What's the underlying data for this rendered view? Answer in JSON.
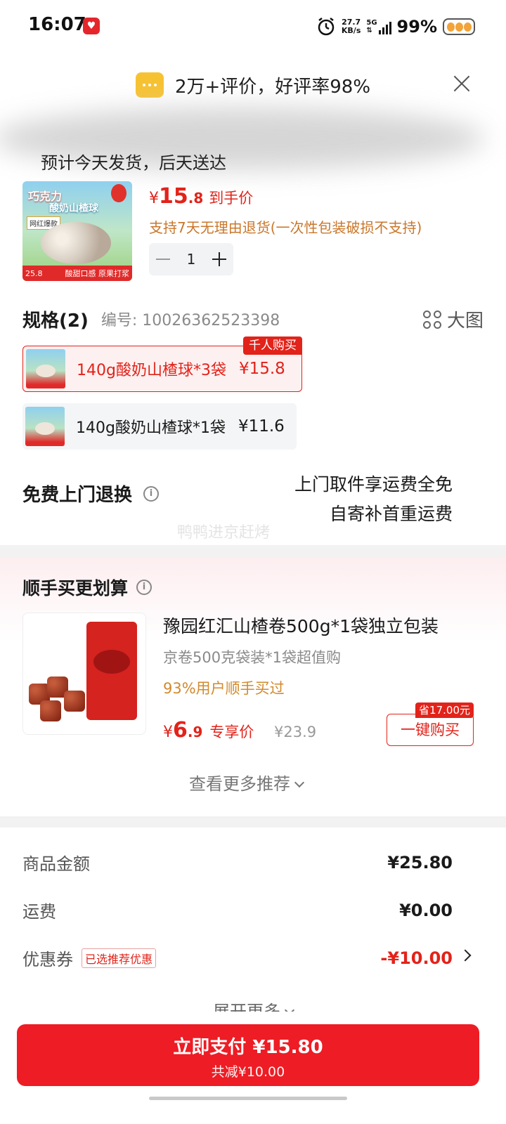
{
  "status": {
    "time": "16:07",
    "net_speed_value": "27.7",
    "net_speed_unit": "KB/s",
    "network": "5G",
    "battery": "99%"
  },
  "header": {
    "tip": "2万+评价，好评率98%"
  },
  "delivery": "预计今天发货，后天送达",
  "product": {
    "image_title": "巧克力",
    "image_subtitle": "酸奶山楂球",
    "image_badge": "网红爆款",
    "image_strip_price": "25.8",
    "image_strip_text": "酸甜口感 原果打浆",
    "price_symbol": "¥",
    "price_int": "15",
    "price_dec": ".8",
    "price_tag": "到手价",
    "return_policy": "支持7天无理由退货(一次性包装破损不支持)",
    "quantity": "1"
  },
  "spec": {
    "title": "规格(2)",
    "code": "编号: 10026362523398",
    "big_view": "大图",
    "options": [
      {
        "label": "140g酸奶山楂球*3袋",
        "price": "¥15.8",
        "badge": "千人购买",
        "selected": true
      },
      {
        "label": "140g酸奶山楂球*1袋",
        "price": "¥11.6",
        "selected": false
      }
    ]
  },
  "free_return": {
    "title": "免费上门退换",
    "line1": "上门取件享运费全免",
    "line2": "自寄补首重运费",
    "watermark": "鸭鸭进京赶烤"
  },
  "recommend": {
    "title": "顺手买更划算",
    "item": {
      "name": "豫园红汇山楂卷500g*1袋独立包装",
      "subtitle": "京卷500克袋装*1袋超值购",
      "popularity": "93%用户顺手买过",
      "price_symbol": "¥",
      "price_int": "6",
      "price_dec": ".9",
      "price_tag": "专享价",
      "original_price": "¥23.9",
      "save_badge": "省17.00元",
      "buy_label": "一键购买"
    },
    "more": "查看更多推荐"
  },
  "summary": {
    "rows": [
      {
        "label": "商品金额",
        "value": "¥25.80"
      },
      {
        "label": "运费",
        "value": "¥0.00"
      },
      {
        "label": "优惠券",
        "tag": "已选推荐优惠",
        "value": "-¥10.00"
      }
    ],
    "expand": "展开更多"
  },
  "pay": {
    "label": "立即支付 ¥15.80",
    "discount": "共减¥10.00"
  },
  "colors": {
    "accent_red": "#e2231a",
    "pay_button": "#ee1c24",
    "orange_text": "#c9772b",
    "tip_icon": "#f7c232"
  },
  "icons": [
    "message-icon",
    "close-icon",
    "alarm-icon",
    "signal-icon",
    "battery-icon",
    "grid-icon",
    "info-icon",
    "chevron-down-icon",
    "chevron-right-icon",
    "minus-icon",
    "plus-icon"
  ]
}
